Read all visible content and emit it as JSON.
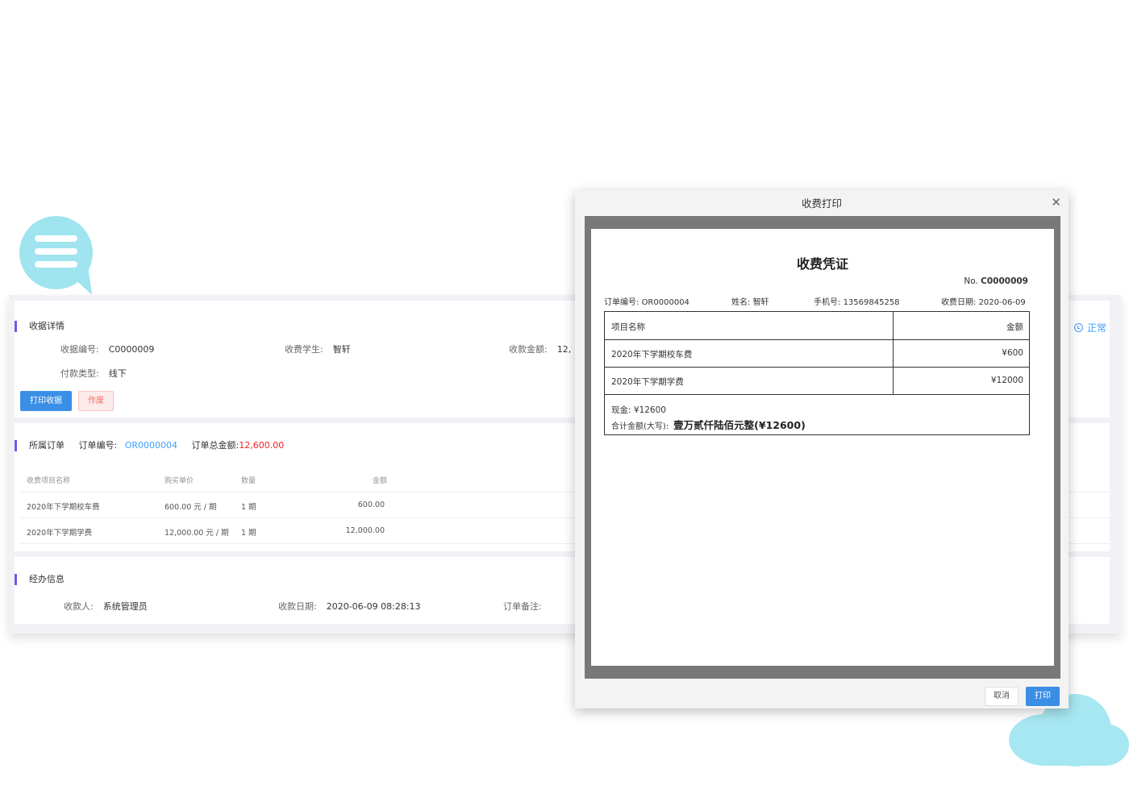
{
  "receipt_detail": {
    "section_title": "收据详情",
    "receipt_no_label": "收据编号:",
    "receipt_no": "C0000009",
    "student_label": "收费学生:",
    "student": "智轩",
    "amount_label": "收款金额:",
    "amount_partial": "12,",
    "pay_type_label": "付款类型:",
    "pay_type": "线下",
    "print_button": "打印收据",
    "void_button": "作废",
    "status": "正常"
  },
  "order": {
    "section_title": "所属订单",
    "order_no_label": "订单编号:",
    "order_no": "OR0000004",
    "total_label": "订单总金额:",
    "total": "12,600.00",
    "columns": [
      "收费项目名称",
      "购买单价",
      "数量",
      "金额"
    ],
    "rows": [
      {
        "name": "2020年下学期校车费",
        "price": "600.00 元 / 期",
        "qty": "1 期",
        "amount": "600.00"
      },
      {
        "name": "2020年下学期学费",
        "price": "12,000.00 元 / 期",
        "qty": "1 期",
        "amount": "12,000.00"
      }
    ]
  },
  "handling": {
    "section_title": "经办信息",
    "payee_label": "收款人:",
    "payee": "系统管理员",
    "date_label": "收款日期:",
    "date": "2020-06-09 08:28:13",
    "remark_label": "订单备注:"
  },
  "dialog": {
    "title": "收费打印",
    "close_icon": "close-icon",
    "cancel_button": "取消",
    "print_button": "打印",
    "receipt": {
      "title": "收费凭证",
      "no_prefix": "No.",
      "no": "C0000009",
      "order_no_label": "订单编号:",
      "order_no": "OR0000004",
      "name_label": "姓名:",
      "name": "智轩",
      "phone_label": "手机号:",
      "phone": "13569845258",
      "date_label": "收费日期:",
      "date": "2020-06-09",
      "header_item": "项目名称",
      "header_amount": "金额",
      "items": [
        {
          "name": "2020年下学期校车费",
          "amount": "¥600"
        },
        {
          "name": "2020年下学期学费",
          "amount": "¥12000"
        }
      ],
      "cash_label": "现金:",
      "cash": "¥12600",
      "total_label": "合计金额(大写):",
      "total_text": "壹万贰仟陆佰元整(¥12600)"
    }
  },
  "colors": {
    "accent": "#3a8ee6",
    "section_bar": "#6c5ce7",
    "danger": "#f02020",
    "link": "#409eff",
    "decor": "#9fe4ef"
  }
}
